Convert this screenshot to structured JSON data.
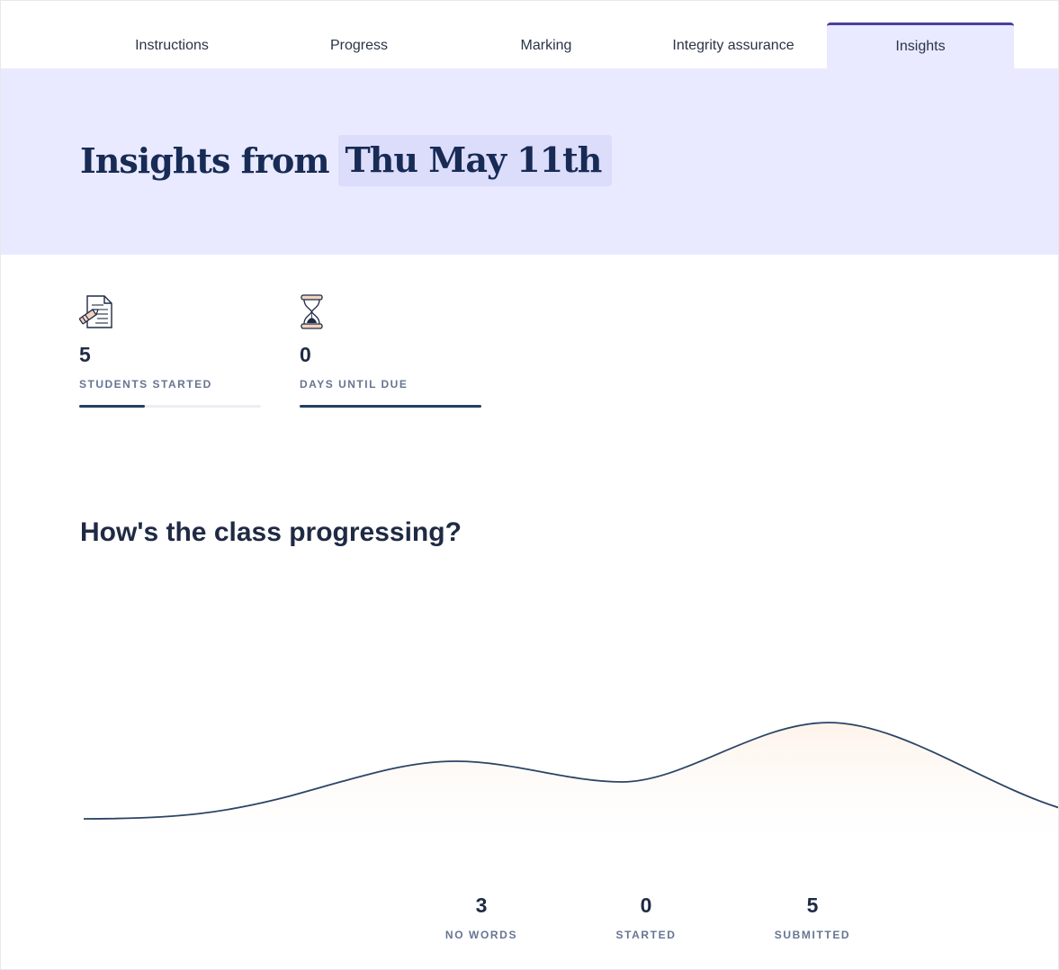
{
  "tabs": [
    {
      "label": "Instructions",
      "active": false
    },
    {
      "label": "Progress",
      "active": false
    },
    {
      "label": "Marking",
      "active": false
    },
    {
      "label": "Integrity assurance",
      "active": false
    },
    {
      "label": "Insights",
      "active": true
    }
  ],
  "hero": {
    "prefix": "Insights from",
    "date": "Thu May 11th"
  },
  "stats": [
    {
      "icon": "document-pencil-icon",
      "value": "5",
      "label": "STUDENTS STARTED",
      "progress": 0.36
    },
    {
      "icon": "hourglass-icon",
      "value": "0",
      "label": "DAYS UNTIL DUE",
      "progress": 1.0
    }
  ],
  "section": {
    "title": "How's the class progressing?"
  },
  "counts": [
    {
      "value": "3",
      "label": "NO WORDS"
    },
    {
      "value": "0",
      "label": "STARTED"
    },
    {
      "value": "5",
      "label": "SUBMITTED"
    }
  ],
  "colors": {
    "accent": "#4b3f9c",
    "hero_bg": "#e9eaff",
    "date_pill_bg": "#dcdcfb",
    "title_navy": "#172b55",
    "bar_fill": "#233f63",
    "curve": "#2b4566",
    "curve_fill": "#fdf3ea"
  }
}
